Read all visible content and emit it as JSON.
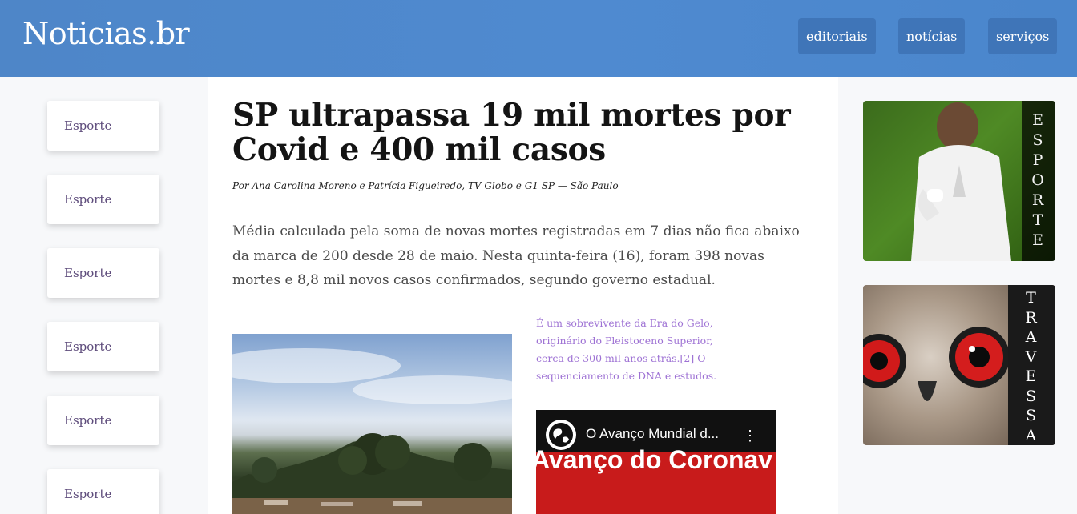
{
  "header": {
    "logo": "Noticias.br",
    "nav": [
      "editoriais",
      "notícias",
      "serviços"
    ],
    "background": "#4e86c8",
    "nav_button_color": "#3f75b8"
  },
  "sidebar": {
    "items": [
      "Esporte",
      "Esporte",
      "Esporte",
      "Esporte",
      "Esporte",
      "Esporte"
    ]
  },
  "article": {
    "headline": "SP ultrapassa 19 mil mortes por Covid e 400 mil casos",
    "byline": "Por Ana Carolina Moreno e Patrícia Figueiredo, TV Globo e G1 SP — São Paulo",
    "lede": "Média calculada pela soma de novas mortes registradas em 7 dias não fica abaixo da marca de 200 desde 28 de maio. Nesta quinta-feira (16), foram 398 novas mortes e 8,8 mil novos casos confirmados, segundo governo estadual.",
    "aside": "É um sobrevivente da Era do Gelo, originário do Pleistoceno Superior, cerca de 300 mil anos atrás.[2] O sequenciamento de DNA e estudos.",
    "aside_color": "#9e72d4",
    "video": {
      "title": "O Avanço Mundial d...",
      "overlay_text": "Avanço do Coronav",
      "menu_icon": "kebab-menu-icon"
    }
  },
  "promos": [
    {
      "label": "ESPORTE",
      "letters": [
        "E",
        "S",
        "P",
        "O",
        "R",
        "T",
        "E"
      ]
    },
    {
      "label": "TRAVESSA",
      "letters": [
        "T",
        "R",
        "A",
        "V",
        "E",
        "S",
        "S",
        "A"
      ]
    }
  ]
}
